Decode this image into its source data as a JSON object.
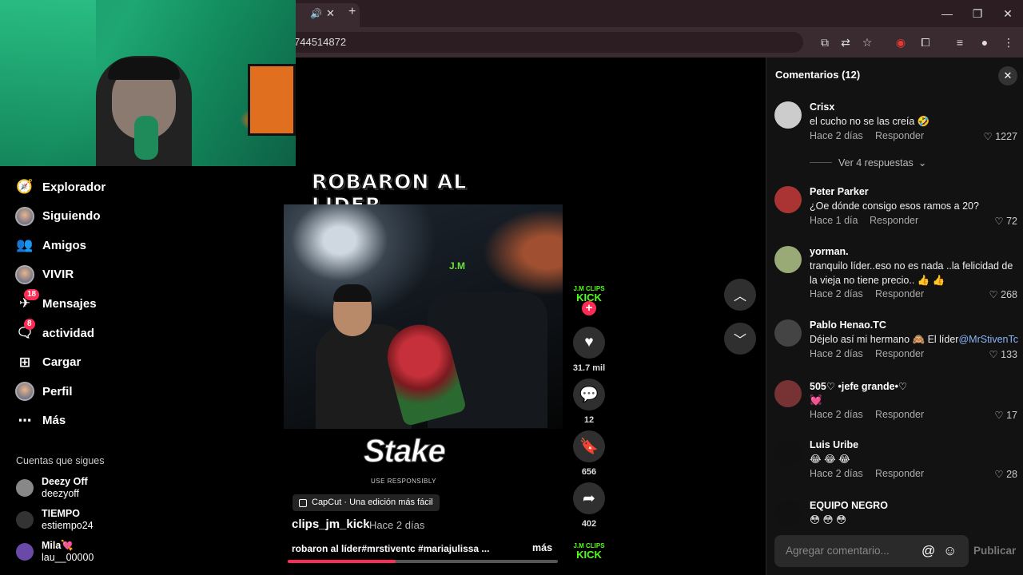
{
  "browser": {
    "url": "744514872",
    "tab_label": "",
    "new_tab_symbol": "+"
  },
  "nav": {
    "items": [
      {
        "label": "Explorador",
        "icon": "compass-icon"
      },
      {
        "label": "Siguiendo",
        "icon": "avatar"
      },
      {
        "label": "Amigos",
        "icon": "friends-icon"
      },
      {
        "label": "VIVIR",
        "icon": "avatar"
      },
      {
        "label": "Mensajes",
        "icon": "messages-icon",
        "badge": "18"
      },
      {
        "label": "actividad",
        "icon": "activity-icon",
        "badge": "8"
      },
      {
        "label": "Cargar",
        "icon": "upload-icon"
      },
      {
        "label": "Perfil",
        "icon": "avatar"
      },
      {
        "label": "Más",
        "icon": "more-icon"
      }
    ],
    "following_title": "Cuentas que sigues",
    "accounts": [
      {
        "name": "Deezy Off",
        "handle": "deezyoff"
      },
      {
        "name": "TIEMPO",
        "handle": "estiempo24"
      },
      {
        "name": "Mila💘",
        "handle": "lau__00000"
      }
    ]
  },
  "video": {
    "overlay_title": "ROBARON AL LIDER",
    "watermark": "J.M",
    "sponsor": "Stake",
    "sponsor_sub": "USE RESPONSIBLY",
    "capcut": "CapCut · Una edición más fácil",
    "author": "clips_jm_kick",
    "date": "· Hace 2 días",
    "caption": "robaron al líder#mrstiventc #mariajulissa ...",
    "more": "más",
    "progress": 0.4
  },
  "actions": {
    "brand_top": "J.M CLIPS",
    "brand_main": "KICK",
    "likes": "31.7 mil",
    "comments": "12",
    "saves": "656",
    "shares": "402"
  },
  "comments": {
    "title": "Comentarios (12)",
    "reply_label": "Responder",
    "view_replies": "Ver 4 respuestas",
    "input_placeholder": "Agregar comentario...",
    "post_label": "Publicar",
    "items": [
      {
        "user": "Crisx",
        "text": "el cucho no se las creía 🤣",
        "time": "Hace 2 días",
        "likes": "1227"
      },
      {
        "user": "Peter Parker",
        "text": "¿Oe dónde consigo esos ramos a 20?",
        "time": "Hace 1 día",
        "likes": "72"
      },
      {
        "user": "yorman.",
        "text": "tranquilo líder..eso no es nada ..la felicidad de la vieja no tiene precio.. 👍 👍",
        "time": "Hace 2 días",
        "likes": "268"
      },
      {
        "user": "Pablo Henao.TC",
        "text": "Déjelo así mi hermano 🙈 El líder",
        "mention": "@MrStivenTc",
        "time": "Hace 2 días",
        "likes": "133"
      },
      {
        "user": "505♡ •jefe grande•♡",
        "text": "💓",
        "time": "Hace 2 días",
        "likes": "17"
      },
      {
        "user": "Luis Uribe",
        "text": "😂 😂 😂",
        "time": "Hace 2 días",
        "likes": "28"
      },
      {
        "user": "EQUIPO NEGRO",
        "text": "😳 😳 😳"
      }
    ]
  },
  "colors": {
    "accent": "#fe2c55",
    "kick_green": "#53fc18",
    "panel_bg": "#121212"
  }
}
